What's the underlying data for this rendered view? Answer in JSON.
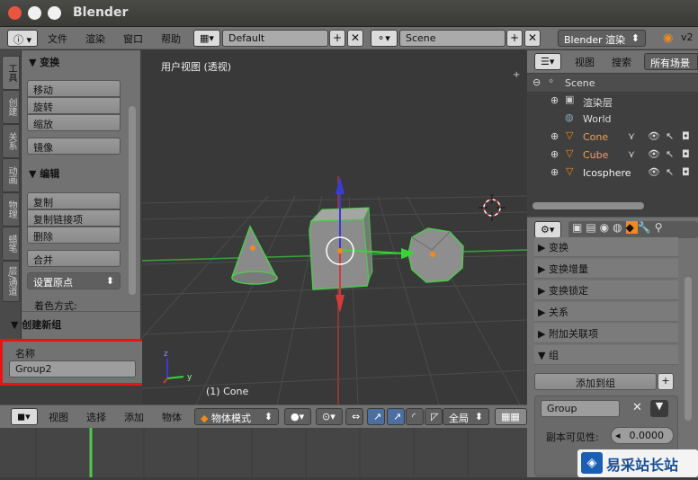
{
  "app": {
    "title": "Blender"
  },
  "menu": {
    "items": [
      "文件",
      "渲染",
      "窗口",
      "帮助"
    ],
    "layout": "Default",
    "scene": "Scene",
    "engine": "Blender 渲染",
    "version": "v2"
  },
  "tabs": [
    "工具",
    "创建",
    "关系",
    "动画",
    "物理",
    "蜡笔",
    "层/通道"
  ],
  "tool": {
    "transform_header": "▼ 变换",
    "move": "移动",
    "rotate": "旋转",
    "scale": "缩放",
    "mirror": "镜像",
    "edit_header": "▼ 编辑",
    "duplicate": "复制",
    "duplicate_linked": "复制链接项",
    "delete": "删除",
    "join": "合并",
    "set_origin": "设置原点",
    "shading": "着色方式:",
    "group_header": "▼ 创建新组",
    "name_label": "名称",
    "name_value": "Group2"
  },
  "viewport": {
    "label": "用户视图 (透视)",
    "object_label": "(1) Cone"
  },
  "bottom": {
    "view": "视图",
    "select": "选择",
    "add": "添加",
    "object": "物体",
    "mode": "物体模式",
    "global": "全局"
  },
  "outliner": {
    "view": "视图",
    "search": "搜索",
    "all_scenes": "所有场景",
    "rows": [
      {
        "label": "Scene",
        "icon": "scene-icon"
      },
      {
        "label": "渲染层",
        "icon": "render-layer-icon"
      },
      {
        "label": "World",
        "icon": "world-icon"
      },
      {
        "label": "Cone",
        "icon": "mesh-object-icon"
      },
      {
        "label": "Cube",
        "icon": "mesh-object-icon"
      },
      {
        "label": "Icosphere",
        "icon": "mesh-object-icon"
      }
    ]
  },
  "properties": {
    "sections": [
      "▶ 变换",
      "▶ 变换增量",
      "▶ 变换锁定",
      "▶ 关系",
      "▶ 附加关联项",
      "▼ 组"
    ],
    "add_to_group": "添加到组",
    "group_name": "Group",
    "dupli_label": "副本可见性:",
    "dupli_value": "0.0000"
  },
  "watermark": "易采站长站",
  "colors": {
    "selected_outline": "#4ec94e",
    "x_axis": "#d43a3a",
    "z_axis": "#3a3ad4",
    "y_axis": "#3ad43a",
    "red_highlight": "#e51515",
    "object_orange": "#f08a1c"
  }
}
